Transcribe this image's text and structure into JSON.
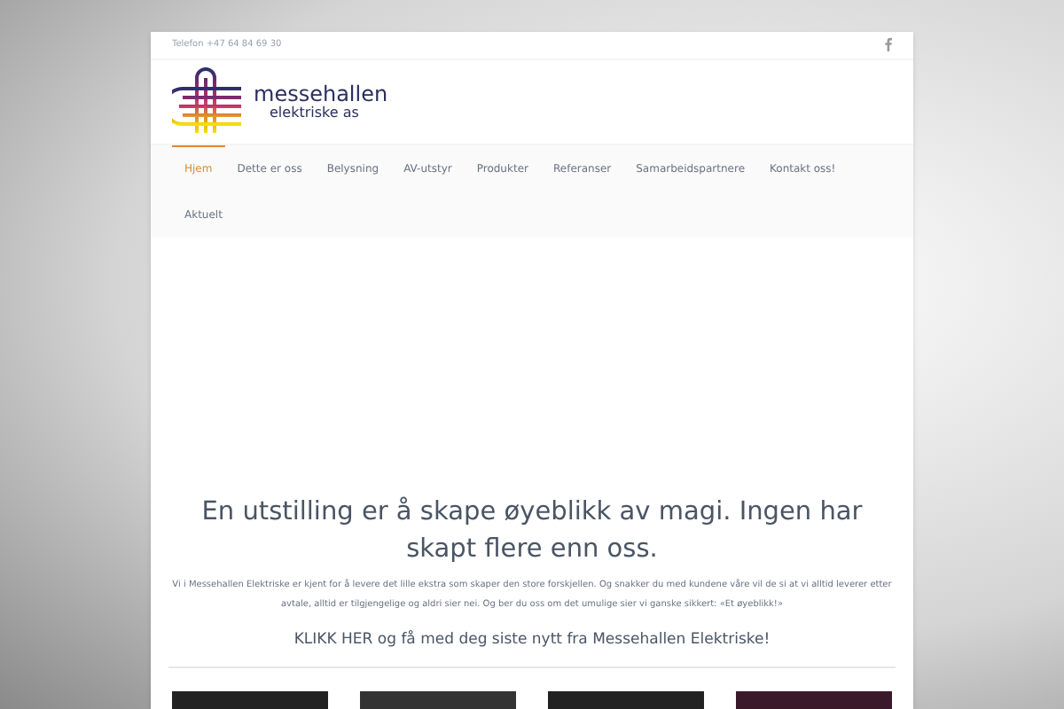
{
  "top_bar": {
    "phone": "Telefon +47 64 84 69 30"
  },
  "logo": {
    "name": "messehallen",
    "tagline": "elektriske as"
  },
  "nav": [
    {
      "label": "Hjem",
      "selected": true
    },
    {
      "label": "Dette er oss",
      "selected": false
    },
    {
      "label": "Belysning",
      "selected": false
    },
    {
      "label": "AV-utstyr",
      "selected": false
    },
    {
      "label": "Produkter",
      "selected": false
    },
    {
      "label": "Referanser",
      "selected": false
    },
    {
      "label": "Samarbeidspartnere",
      "selected": false
    },
    {
      "label": "Kontakt oss!",
      "selected": false
    },
    {
      "label": "Aktuelt",
      "selected": false
    }
  ],
  "content": {
    "heading": "En utstilling er å skape øyeblikk av magi. Ingen har skapt flere enn oss.",
    "paragraph": "Vi i Messehallen Elektriske er kjent for å levere det lille ekstra som skaper den store forskjellen. Og snakker du med kundene våre vil de si at vi alltid leverer etter avtale, alltid er tilgjengelige og aldri sier nei. Og ber du oss om det umulige sier vi ganske sikkert: «Et øyeblikk!»",
    "link": "KLIKK HER og få med deg siste nytt fra Messehallen Elektriske!"
  }
}
